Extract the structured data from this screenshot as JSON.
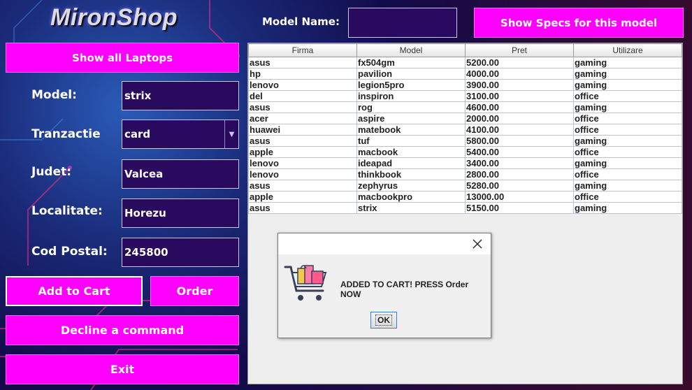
{
  "app": {
    "logo": "MironShop"
  },
  "header": {
    "model_name_label": "Model Name:",
    "model_name_value": "",
    "show_specs_label": "Show Specs for this model"
  },
  "sidebar": {
    "show_all_label": "Show all Laptops",
    "form": {
      "model_label": "Model:",
      "model_value": "strix",
      "tranzactie_label": "Tranzactie",
      "tranzactie_value": "card",
      "judet_label": "Judet:",
      "judet_value": "Valcea",
      "localitate_label": "Localitate:",
      "localitate_value": "Horezu",
      "cod_postal_label": "Cod Postal:",
      "cod_postal_value": "245800"
    },
    "add_to_cart_label": "Add to Cart",
    "order_label": "Order",
    "decline_label": "Decline a command",
    "exit_label": "Exit"
  },
  "table": {
    "columns": [
      "Firma",
      "Model",
      "Pret",
      "Utilizare"
    ],
    "rows": [
      [
        "asus",
        "fx504gm",
        "5200.00",
        "gaming"
      ],
      [
        "hp",
        "pavilion",
        "4000.00",
        "gaming"
      ],
      [
        "lenovo",
        "legion5pro",
        "3900.00",
        "gaming"
      ],
      [
        "del",
        "inspiron",
        "3100.00",
        "office"
      ],
      [
        "asus",
        "rog",
        "4600.00",
        "gaming"
      ],
      [
        "acer",
        "aspire",
        "2000.00",
        "office"
      ],
      [
        "huawei",
        "matebook",
        "4100.00",
        "office"
      ],
      [
        "asus",
        "tuf",
        "5800.00",
        "gaming"
      ],
      [
        "apple",
        "macbook",
        "5400.00",
        "office"
      ],
      [
        "lenovo",
        "ideapad",
        "3400.00",
        "gaming"
      ],
      [
        "lenovo",
        "thinkbook",
        "2800.00",
        "office"
      ],
      [
        "asus",
        "zephyrus",
        "5280.00",
        "gaming"
      ],
      [
        "apple",
        "macbookpro",
        "13000.00",
        "office"
      ],
      [
        "asus",
        "strix",
        "5150.00",
        "gaming"
      ]
    ]
  },
  "dialog": {
    "message": "ADDED TO CART! PRESS Order NOW",
    "ok_label": "OK",
    "icon": "shopping-cart-icon"
  },
  "colors": {
    "accent": "#ff00ff",
    "field_bg": "#2a0a5e"
  }
}
